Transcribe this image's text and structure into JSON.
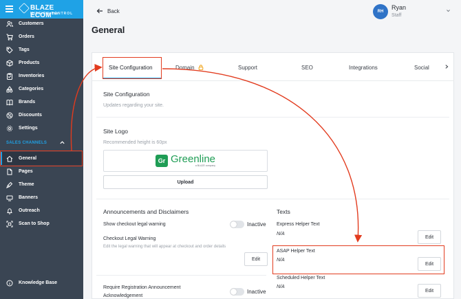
{
  "app": {
    "brand": "BLAZE ECOM™",
    "brand_sub": "MISSION CONTROL"
  },
  "sidebar": {
    "items": [
      {
        "label": "Customers",
        "icon": "users-icon"
      },
      {
        "label": "Orders",
        "icon": "cart-icon"
      },
      {
        "label": "Tags",
        "icon": "tag-icon"
      },
      {
        "label": "Products",
        "icon": "box-icon"
      },
      {
        "label": "Inventories",
        "icon": "clipboard-icon"
      },
      {
        "label": "Categories",
        "icon": "categories-icon"
      },
      {
        "label": "Brands",
        "icon": "book-icon"
      },
      {
        "label": "Discounts",
        "icon": "discount-icon"
      },
      {
        "label": "Settings",
        "icon": "gear-icon"
      }
    ],
    "section_label": "SALES CHANNELS",
    "channel_items": [
      {
        "label": "General",
        "icon": "home-icon",
        "active": true
      },
      {
        "label": "Pages",
        "icon": "pages-icon"
      },
      {
        "label": "Theme",
        "icon": "theme-icon"
      },
      {
        "label": "Banners",
        "icon": "banner-icon"
      },
      {
        "label": "Outreach",
        "icon": "bell-icon"
      },
      {
        "label": "Scan to Shop",
        "icon": "scan-icon"
      }
    ],
    "footer_item": {
      "label": "Knowledge Base",
      "icon": "info-icon"
    }
  },
  "header": {
    "back_label": "Back",
    "user": {
      "initials": "RH",
      "name": "Ryan",
      "role": "Staff"
    },
    "page_title": "General"
  },
  "tabs": [
    {
      "label": "Site Configuration",
      "active": true
    },
    {
      "label": "Domain",
      "locked": true
    },
    {
      "label": "Support"
    },
    {
      "label": "SEO"
    },
    {
      "label": "Integrations"
    },
    {
      "label": "Social"
    }
  ],
  "site_config": {
    "title": "Site Configuration",
    "subtitle": "Updates regarding your site."
  },
  "site_logo": {
    "title": "Site Logo",
    "hint": "Recommended height is 60px",
    "logo_text": "Greenline",
    "logo_mark": "Gr",
    "logo_sub": "a BLAZE company",
    "upload_label": "Upload"
  },
  "announcements": {
    "title": "Announcements and Disclaimers",
    "show_warning_label": "Show checkout legal warning",
    "show_warning_state": "Inactive",
    "legal_warning_title": "Checkout Legal Warning",
    "legal_warning_desc": "Edit the legal warning that will appear at checkout and order details",
    "edit_label": "Edit",
    "registration_label_1": "Require Registration Announcement",
    "registration_label_2": "Acknowledgement",
    "registration_state": "Inactive"
  },
  "texts": {
    "title": "Texts",
    "items": [
      {
        "label": "Express Helper Text",
        "value": "N/A",
        "edit": "Edit"
      },
      {
        "label": "ASAP Helper Text",
        "value": "N/A",
        "edit": "Edit"
      },
      {
        "label": "Scheduled Helper Text",
        "value": "N/A",
        "edit": "Edit"
      }
    ]
  },
  "colors": {
    "accent": "#1fa2e6",
    "sidebar": "#3a4553",
    "annotation": "#e23b1e",
    "logo_green": "#1f9d55"
  }
}
